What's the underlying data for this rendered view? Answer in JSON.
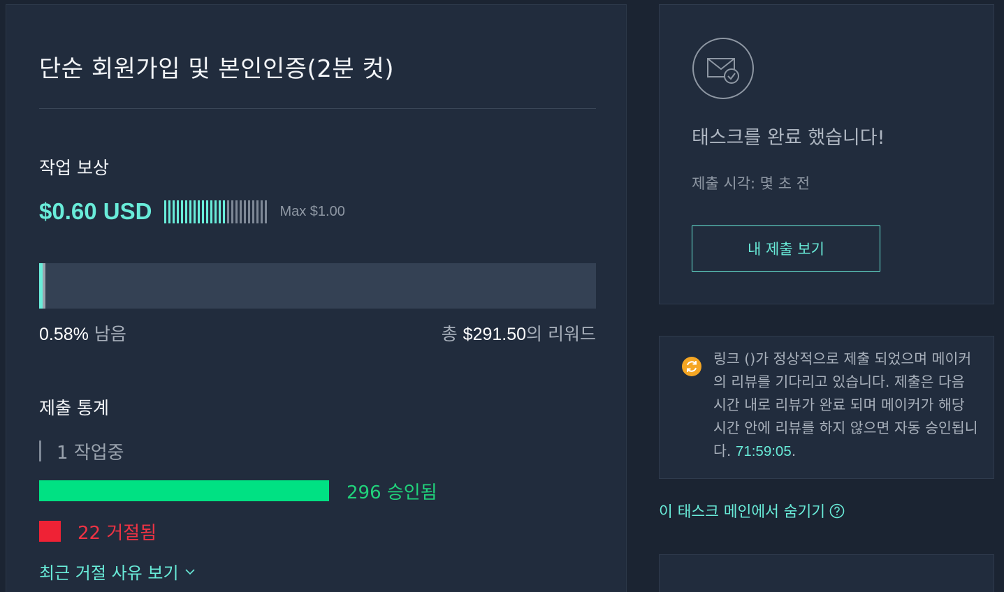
{
  "task": {
    "title": "단순 회원가입 및 본인인증(2분 컷)"
  },
  "reward": {
    "section_label": "작업 보상",
    "amount": "$0.60 USD",
    "max": "Max $1.00",
    "level_filled": 0.6,
    "accent_color": "#69ecd9"
  },
  "budget": {
    "remaining_percent": 0.58,
    "remaining_value": "0.58%",
    "remaining_suffix": "남음",
    "total_prefix": "총",
    "total_value": "$291.50",
    "total_suffix": "의 리워드"
  },
  "stats": {
    "section_label": "제출 통계",
    "in_progress": "1 작업중",
    "approved_count": 296,
    "approved_label": "296 승인됨",
    "rejected_count": 22,
    "rejected_label": "22 거절됨",
    "reasons_link": "최근 거절 사유 보기",
    "approved_color": "#00e183",
    "rejected_color": "#ef2235"
  },
  "complete_card": {
    "icon": "mail-check-icon",
    "title": "태스크를 완료 했습니다!",
    "submit_time": "제출 시각: 몇 초 전",
    "view_button": "내 제출 보기"
  },
  "notice": {
    "icon": "sync-icon",
    "text": "링크 ()가 정상적으로 제출 되었으며 메이커의 리뷰를 기다리고 있습니다. 제출은 다음 시간 내로 리뷰가 완료 되며 메이커가 해당 시간 안에 리뷰를 하지 않으면 자동 승인됩니다.",
    "timer": "71:59:05",
    "text_end": "."
  },
  "hide_link": {
    "label": "이 태스크 메인에서 숨기기",
    "icon": "help-icon"
  }
}
